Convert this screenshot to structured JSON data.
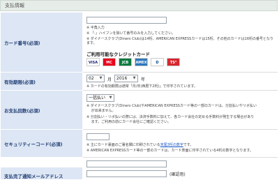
{
  "section_title": "支払情報",
  "card_number": {
    "label": "カード番号(必須)",
    "value": "",
    "notes": [
      "※ 半角入力",
      "※ 「-」ハイフンを除いて番号のみを入力してください。",
      "※ ダイナースクラブ(Diners Club)は14桁、AMERICAN EXPRESSカードは15桁、その他のカードは16桁の番号となります。"
    ],
    "cards_title": "ご利用可能なクレジットカード",
    "cards": [
      {
        "icon": "visa-icon",
        "text": "VISA",
        "color": "#1a1f71",
        "bg": "#ffffff"
      },
      {
        "icon": "mastercard-icon",
        "text": "MC",
        "color": "#ffffff",
        "bg": "#eb001b"
      },
      {
        "icon": "jcb-icon",
        "text": "JCB",
        "color": "#ffffff",
        "bg": "#0b7a3e"
      },
      {
        "icon": "amex-icon",
        "text": "AMEX",
        "color": "#ffffff",
        "bg": "#2e77bc"
      },
      {
        "icon": "diners-icon",
        "text": "D",
        "color": "#004a97",
        "bg": "#ffffff"
      },
      {
        "icon": "ts3-icon",
        "text": "TS³",
        "color": "#ffffff",
        "bg": "#d8262e"
      }
    ]
  },
  "expiry": {
    "label": "有効期限(必須)",
    "month": "02",
    "month_unit": "月",
    "year": "2016",
    "year_unit": "年",
    "note": "※ カードの有効期限は通常「月/年(西暦下2桁)」で印字されています。"
  },
  "payment_count": {
    "label": "お支払回数(必須)",
    "selected": "一括払い",
    "notes": [
      "※ ダイナースクラブ(Diners Club)やAMERICAN EXPRESSカード等の一部のカードは、分割払いやリボ払い",
      "　 が出来ません。",
      "※ 分割払い・リボ払いの際には、決済手数料に加えて、各カード会社の定める手数料が発生する場合があり",
      "　 ます。ご利用の前にカード会社にご確認ください。"
    ]
  },
  "security_code": {
    "label": "セキュリティーコード(必須)",
    "value": "",
    "note1_prefix": "※ 主にカード裏面のご署名欄に印刷されている",
    "note1_link": "末尾3桁の数字",
    "note1_suffix": "です。",
    "note2": "※ AMERICAN EXPRESSカード等の一部のカードは、カード表面に印字されている4桁の数字となります。"
  },
  "email": {
    "label": "支払完了通知メールアドレス",
    "value": "",
    "confirm_value": "",
    "confirm_label": "(確認用)"
  },
  "colors": {
    "label_bg": "#dde6f4",
    "label_text": "#1f3d73",
    "bullet": "#c0392b",
    "link": "#1a57c7"
  }
}
